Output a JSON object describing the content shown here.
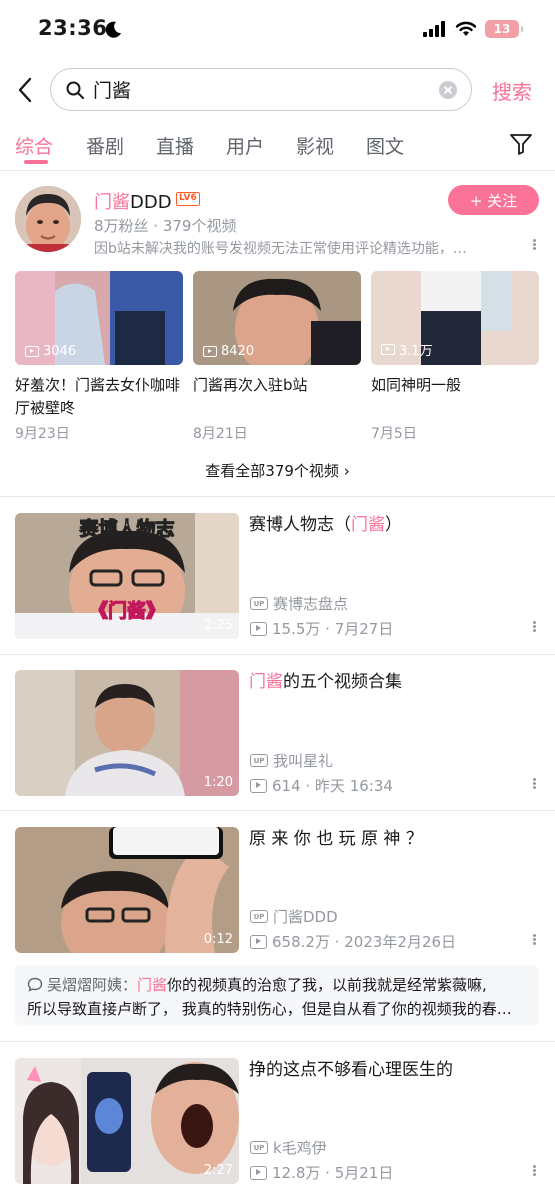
{
  "status_bar": {
    "time": "23:36",
    "battery": "13"
  },
  "search": {
    "query": "门酱",
    "button": "搜索"
  },
  "tabs": [
    "综合",
    "番剧",
    "直播",
    "用户",
    "影视",
    "图文"
  ],
  "user_card": {
    "name_highlight": "门酱",
    "name_rest": "DDD",
    "level": "LV6",
    "follow_label": "+ 关注",
    "stats": "8万粉丝 · 379个视频",
    "sign": "因b站未解决我的账号发视频无法正常使用评论精选功能，…",
    "videos": [
      {
        "count": "3046",
        "title": "好羞次！门酱去女仆咖啡厅被壁咚",
        "date": "9月23日"
      },
      {
        "count": "8420",
        "title": "门酱再次入驻b站",
        "date": "8月21日"
      },
      {
        "count": "3.1万",
        "title": "如同神明一般",
        "date": "7月5日"
      }
    ],
    "view_all": "查看全部379个视频 ›"
  },
  "results": [
    {
      "title_pre": "赛博人物志（",
      "title_hl": "门酱",
      "title_post": "）",
      "duration": "2:25",
      "up": "赛博志盘点",
      "meta": "15.5万 · 7月27日",
      "overlay_top": "赛博人物志",
      "overlay_bottom": "《门酱》"
    },
    {
      "title_pre": "",
      "title_hl": "门酱",
      "title_post": "的五个视频合集",
      "duration": "1:20",
      "up": "我叫星礼",
      "meta": "614 · 昨天 16:34"
    },
    {
      "title_pre": "原 来 你 也 玩 原 神 ？",
      "title_hl": "",
      "title_post": "",
      "duration": "0:12",
      "up": "门酱DDD",
      "meta": "658.2万 · 2023年2月26日"
    },
    {
      "title_pre": "挣的这点不够看心理医生的",
      "title_hl": "",
      "title_post": "",
      "duration": "2:27",
      "up": "k毛鸡伊",
      "meta": "12.8万 · 5月21日"
    }
  ],
  "comment": {
    "user": "吴熠熠阿姨：",
    "highlight": "门酱",
    "text1": "你的视频真的治愈了我，以前我就是经常紫薇嘛,",
    "text2": "所以导致直接卢断了， 我真的特别伤心，但是自从看了你的视频我的春…"
  },
  "up_badge": "UP",
  "colors": {
    "accent": "#fb7299",
    "secondary_text": "#9499a0"
  }
}
